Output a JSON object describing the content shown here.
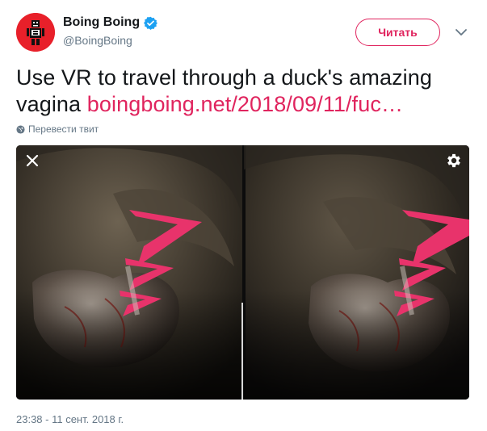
{
  "author": {
    "display_name": "Boing Boing",
    "handle": "@BoingBoing",
    "verified": true,
    "avatar_color": "#e8202a"
  },
  "follow_button": {
    "label": "Читать",
    "color": "#e0245e"
  },
  "tweet": {
    "text": "Use VR to travel through a duck's amazing vagina ",
    "link": "boingboing.net/2018/09/11/fuc…",
    "link_color": "#e0245e"
  },
  "translate": {
    "label": "Перевести твит"
  },
  "media": {
    "icons": {
      "close": "close-icon",
      "settings": "gear-icon"
    },
    "chevron_color": "#e8336b"
  },
  "timestamp": "23:38 - 11 сент. 2018 г."
}
